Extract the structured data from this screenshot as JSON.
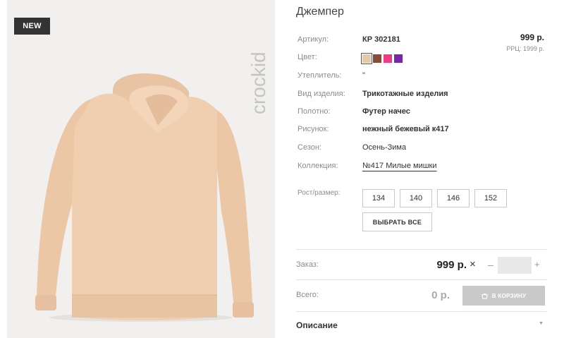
{
  "product": {
    "badge": "NEW",
    "brand_watermark": "crockid",
    "title": "Джемпер",
    "price": "999 р.",
    "rrc": "РРЦ: 1999 р."
  },
  "specs": [
    {
      "label": "Артикул:",
      "value": "КР 302181"
    },
    {
      "label": "Цвет:",
      "value": ""
    },
    {
      "label": "Утеплитель:",
      "value": "\""
    },
    {
      "label": "Вид изделия:",
      "value": "Трикотажные изделия"
    },
    {
      "label": "Полотно:",
      "value": "Футер начес"
    },
    {
      "label": "Рисунок:",
      "value": "нежный бежевый к417"
    },
    {
      "label": "Сезон:",
      "value": "Осень-Зима"
    },
    {
      "label": "Коллекция:",
      "value": "№417 Милые мишки"
    }
  ],
  "colors": [
    {
      "name": "beige",
      "hex": "#e6c9a8",
      "selected": true
    },
    {
      "name": "brown",
      "hex": "#8a4a3a",
      "selected": false
    },
    {
      "name": "pink",
      "hex": "#ee3d86",
      "selected": false
    },
    {
      "name": "purple",
      "hex": "#7a26a8",
      "selected": false
    }
  ],
  "sizes": {
    "label": "Рост/размер:",
    "options": [
      "134",
      "140",
      "146",
      "152"
    ],
    "select_all": "ВЫБРАТЬ ВСЕ"
  },
  "order": {
    "label": "Заказ:",
    "price": "999 р.",
    "times": "×",
    "minus": "–",
    "plus": "+",
    "quantity": ""
  },
  "total": {
    "label": "Всего:",
    "value": "0 р.",
    "cart_button": "В КОРЗИНУ"
  },
  "description": {
    "title": "Описание"
  }
}
